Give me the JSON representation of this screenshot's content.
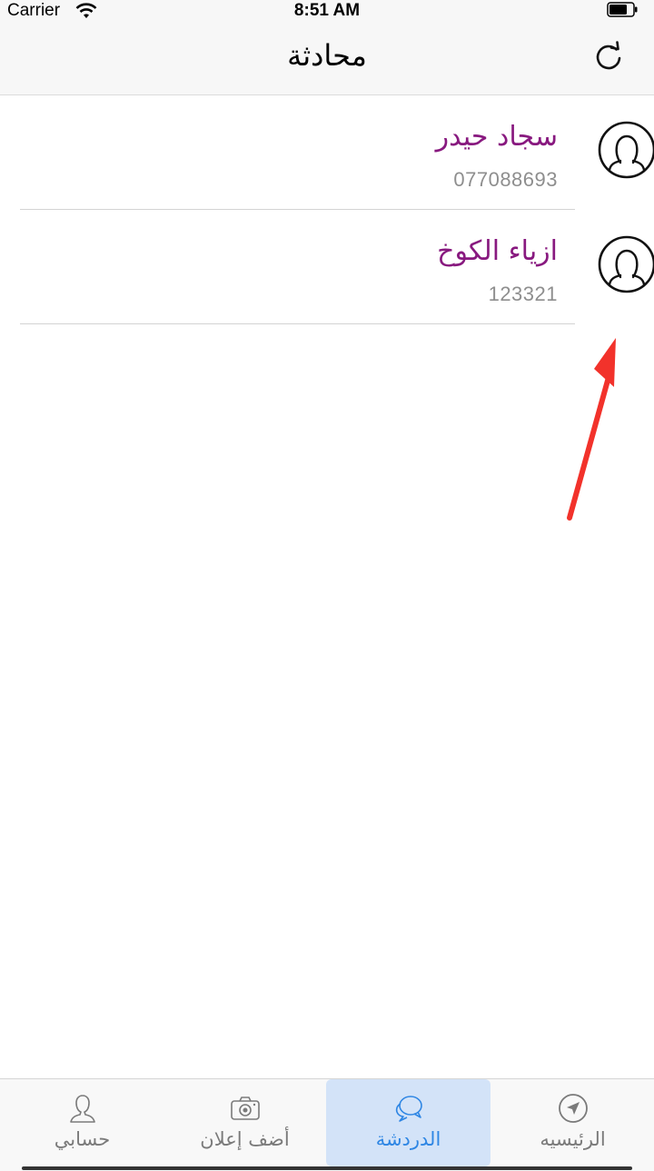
{
  "status_bar": {
    "carrier": "Carrier",
    "time": "8:51 AM"
  },
  "nav": {
    "title": "محادثة",
    "refresh_icon": "refresh-icon"
  },
  "chats": [
    {
      "name": "سجاد حيدر",
      "number": "077088693",
      "avatar_icon": "user-avatar-icon"
    },
    {
      "name": "ازياء الكوخ",
      "number": "123321",
      "avatar_icon": "user-avatar-icon"
    }
  ],
  "tabs": [
    {
      "label": "حسابي",
      "icon": "person-icon",
      "active": false
    },
    {
      "label": "أضف إعلان",
      "icon": "camera-icon",
      "active": false
    },
    {
      "label": "الدردشة",
      "icon": "chat-bubbles-icon",
      "active": true
    },
    {
      "label": "الرئيسيه",
      "icon": "navigation-icon",
      "active": false
    }
  ],
  "colors": {
    "accent": "#2e86e4",
    "name": "#88197f",
    "annotation_arrow": "#f2322b"
  }
}
